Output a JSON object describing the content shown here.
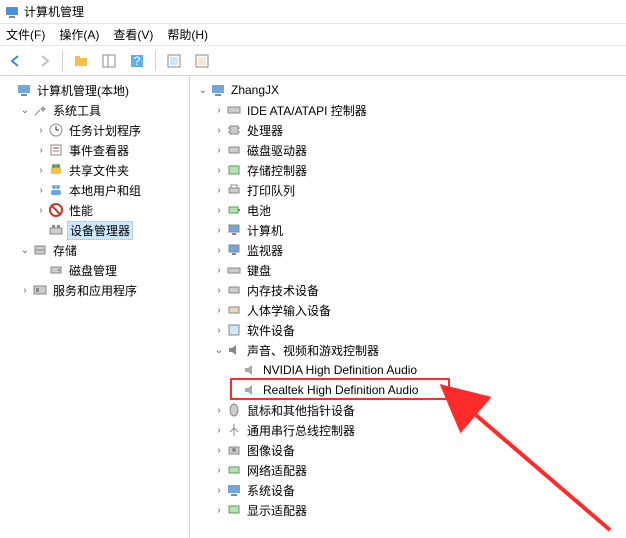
{
  "window": {
    "title": "计算机管理"
  },
  "menu": {
    "file": "文件(F)",
    "action": "操作(A)",
    "view": "查看(V)",
    "help": "帮助(H)"
  },
  "left_tree": {
    "root": "计算机管理(本地)",
    "system_tools": "系统工具",
    "task_scheduler": "任务计划程序",
    "event_viewer": "事件查看器",
    "shared_folders": "共享文件夹",
    "users_groups": "本地用户和组",
    "performance": "性能",
    "device_manager": "设备管理器",
    "storage": "存储",
    "disk_management": "磁盘管理",
    "services": "服务和应用程序"
  },
  "right_tree": {
    "root": "ZhangJX",
    "ide": "IDE ATA/ATAPI 控制器",
    "cpu": "处理器",
    "disk_drive": "磁盘驱动器",
    "storage_ctrl": "存储控制器",
    "print_queue": "打印队列",
    "battery": "电池",
    "computer": "计算机",
    "monitor": "监视器",
    "keyboard": "键盘",
    "memory": "内存技术设备",
    "hid": "人体学输入设备",
    "software": "软件设备",
    "sound": "声音、视频和游戏控制器",
    "audio1": "NVIDIA High Definition Audio",
    "audio2": "Realtek High Definition Audio",
    "mouse": "鼠标和其他指针设备",
    "usb": "通用串行总线控制器",
    "image": "图像设备",
    "network": "网络适配器",
    "system": "系统设备",
    "display": "显示适配器"
  }
}
